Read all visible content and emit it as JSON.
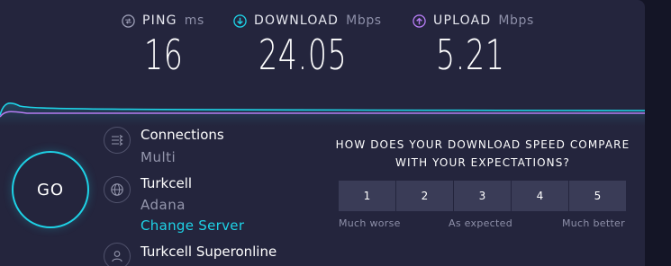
{
  "metrics": {
    "ping": {
      "name": "PING",
      "unit": "ms",
      "value": "16"
    },
    "download": {
      "name": "DOWNLOAD",
      "unit": "Mbps",
      "value": "24.05"
    },
    "upload": {
      "name": "UPLOAD",
      "unit": "Mbps",
      "value": "5.21"
    }
  },
  "go_label": "GO",
  "server": {
    "connections": {
      "title": "Connections",
      "value": "Multi"
    },
    "host": {
      "title": "Turkcell",
      "location": "Adana",
      "change_label": "Change Server"
    },
    "provider": {
      "title": "Turkcell Superonline"
    }
  },
  "survey": {
    "question_line1": "HOW DOES YOUR DOWNLOAD SPEED COMPARE",
    "question_line2": "WITH YOUR EXPECTATIONS?",
    "options": [
      "1",
      "2",
      "3",
      "4",
      "5"
    ],
    "scale_low": "Much worse",
    "scale_mid": "As expected",
    "scale_high": "Much better"
  },
  "colors": {
    "accent": "#1ed2e6",
    "upload": "#b57cf2",
    "ping_icon": "#9a9cb4",
    "panel": "#24253d"
  }
}
